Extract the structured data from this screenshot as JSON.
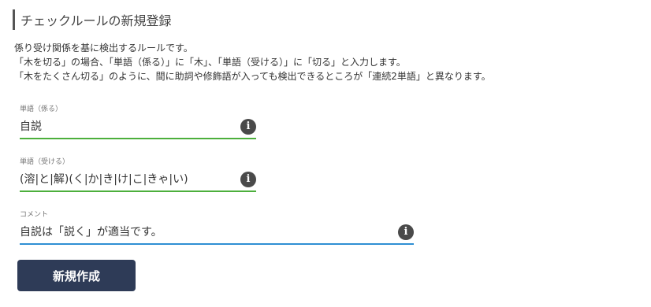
{
  "header": {
    "title": "チェックルールの新規登録"
  },
  "description": {
    "lines": [
      "係り受け関係を基に検出するルールです。",
      "「木を切る」の場合、「単語（係る）」に「木」、「単語（受ける）」に「切る」と入力します。",
      "「木をたくさん切る」のように、間に助詞や修飾語が入っても検出できるところが「連続2単語」と異なります。"
    ]
  },
  "form": {
    "word_governing": {
      "label": "単語（係る）",
      "value": "自説",
      "icon": "info-icon"
    },
    "word_dependent": {
      "label": "単語（受ける）",
      "value": "(溶|と|解)(く|か|き|け|こ|きゃ|い)",
      "icon": "info-icon"
    },
    "comment": {
      "label": "コメント",
      "value": "自説は「説く」が適当です。",
      "icon": "info-icon"
    },
    "submit_label": "新規作成"
  },
  "colors": {
    "accent_green": "#4caf3c",
    "accent_blue": "#2f8fd3",
    "button_bg": "#2e3b57"
  }
}
